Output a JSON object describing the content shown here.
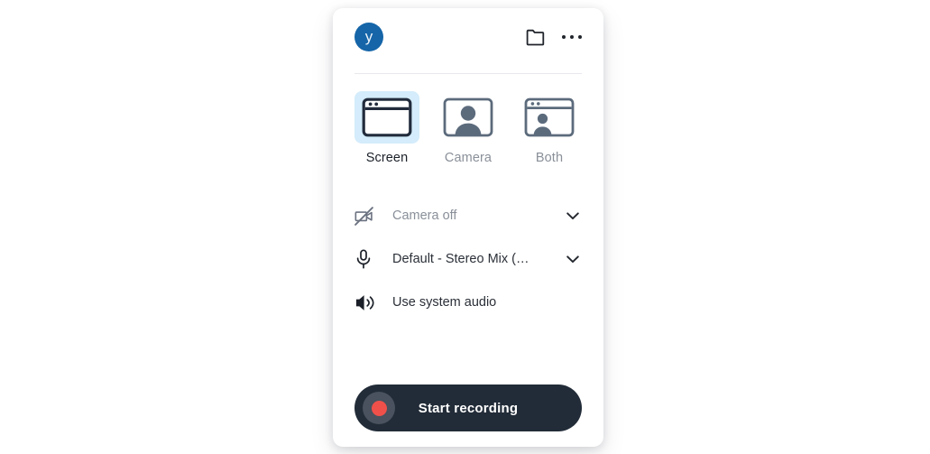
{
  "app": {
    "header": {
      "avatar_initial": "y",
      "folder_icon": "folder-icon",
      "menu_icon": "more-options-icon"
    },
    "modes": [
      {
        "id": "screen",
        "label": "Screen",
        "icon": "screen-window-icon",
        "selected": true
      },
      {
        "id": "camera",
        "label": "Camera",
        "icon": "camera-person-icon",
        "selected": false
      },
      {
        "id": "both",
        "label": "Both",
        "icon": "screen-and-person-icon",
        "selected": false
      }
    ],
    "options": [
      {
        "id": "camera",
        "label": "Camera off",
        "icon": "camera-off-icon",
        "muted": true,
        "chevron": true
      },
      {
        "id": "microphone",
        "label": "Default - Stereo Mix (…",
        "icon": "microphone-icon",
        "muted": false,
        "chevron": true
      },
      {
        "id": "system-audio",
        "label": "Use system audio",
        "icon": "speaker-icon",
        "muted": false,
        "chevron": false
      }
    ],
    "record_button": {
      "label": "Start recording",
      "indicator": "record-dot"
    },
    "colors": {
      "avatar_blue": "#1565a8",
      "selected_highlight": "#d4ecfb",
      "record_button_bg": "#222c38",
      "record_dot_red": "#f0504a",
      "icon_dark": "#1b2028",
      "text_muted": "#8a9099"
    }
  }
}
